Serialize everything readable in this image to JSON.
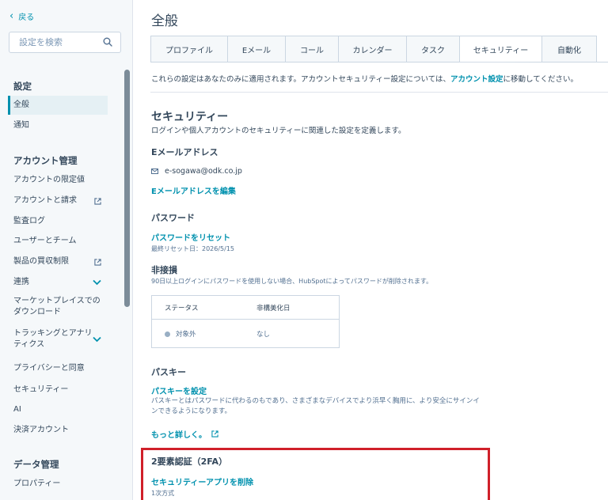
{
  "sidebar": {
    "back_label": "戻る",
    "search_placeholder": "設定を検索",
    "sections": [
      {
        "heading": "設定",
        "items": [
          {
            "label": "全般",
            "active": true
          },
          {
            "label": "通知"
          }
        ]
      },
      {
        "heading": "アカウント管理",
        "items": [
          {
            "label": "アカウントの限定値"
          },
          {
            "label": "アカウントと請求",
            "icon": "external-link-icon"
          },
          {
            "label": "監査ログ"
          },
          {
            "label": "ユーザーとチーム"
          },
          {
            "label": "製品の買収制限",
            "icon": "external-link-icon"
          },
          {
            "label": "連携",
            "icon": "chevron-down-icon"
          },
          {
            "label": "マーケットプレイスでのダウンロード"
          },
          {
            "label": "トラッキングとアナリティクス",
            "icon": "chevron-down-icon"
          },
          {
            "label": "プライバシーと同意"
          },
          {
            "label": "セキュリティー"
          },
          {
            "label": "AI"
          },
          {
            "label": "決済アカウント"
          }
        ]
      },
      {
        "heading": "データ管理",
        "items": [
          {
            "label": "プロパティー"
          }
        ]
      }
    ]
  },
  "main": {
    "page_title": "全般",
    "tabs": [
      "プロファイル",
      "Eメール",
      "コール",
      "カレンダー",
      "タスク",
      "セキュリティー",
      "自動化"
    ],
    "active_tab": "セキュリティー",
    "info_prefix": "これらの設定はあなたのみに適用されます。アカウントセキュリティー設定については、",
    "info_link": "アカウント設定",
    "info_suffix": "に移動してください。",
    "security": {
      "title": "セキュリティー",
      "description": "ログインや個人アカウントのセキュリティーに関連した設定を定義します。"
    },
    "email": {
      "heading": "Eメールアドレス",
      "value": "e-sogawa@odk.co.jp",
      "edit_link": "Eメールアドレスを編集"
    },
    "password": {
      "heading": "パスワード",
      "reset_link": "パスワードをリセット",
      "last_reset": "最終リセット日：2026/5/15"
    },
    "inactive": {
      "heading": "非接損",
      "description": "90日以上ログインにパスワードを使用しない場合、HubSpotによってパスワードが削除されます。",
      "table": {
        "headers": [
          "ステータス",
          "非構美化日"
        ],
        "row": {
          "status": "対象外",
          "date": "なし"
        }
      }
    },
    "passkey": {
      "heading": "パスキー",
      "setup_link": "パスキーを設定",
      "description": "パスキーとはパスワードに代わるのもであり、さまざまなデバイスでより浜早く胸用に、より安全にサインインできるようになります。",
      "learn_more": "もっと詳しく。"
    },
    "twofa": {
      "heading": "2要素認証（2FA）",
      "remove_link": "セキュリティーアプリを削除",
      "method": "1次方式"
    }
  },
  "colors": {
    "accent": "#0091ae",
    "text": "#33475b",
    "highlight": "#d0202a"
  }
}
